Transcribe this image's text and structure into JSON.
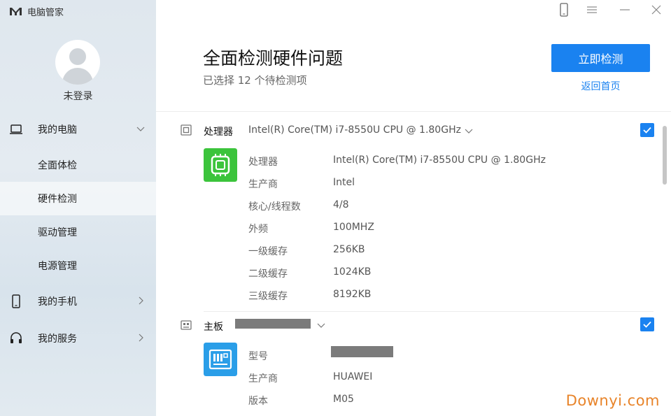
{
  "app": {
    "title": "电脑管家"
  },
  "user": {
    "login_label": "未登录"
  },
  "sidebar": {
    "groups": [
      {
        "label": "我的电脑",
        "icon": "laptop-icon",
        "expanded": true,
        "items": [
          "全面体检",
          "硬件检测",
          "驱动管理",
          "电源管理"
        ],
        "active_item": "硬件检测"
      },
      {
        "label": "我的手机",
        "icon": "phone-icon",
        "expanded": false
      },
      {
        "label": "我的服务",
        "icon": "headset-icon",
        "expanded": false
      }
    ]
  },
  "titlebar": {
    "icons": [
      "phone-icon",
      "menu-icon",
      "minimize-icon",
      "close-icon"
    ]
  },
  "header": {
    "title": "全面检测硬件问题",
    "subtitle": "已选择 12 个待检测项",
    "primary_button": "立即检测",
    "back_link": "返回首页"
  },
  "sections": {
    "cpu": {
      "name": "处理器",
      "model": "Intel(R) Core(TM) i7-8550U CPU @ 1.80GHz",
      "checked": true,
      "rows": [
        {
          "key": "处理器",
          "value": "Intel(R) Core(TM) i7-8550U CPU @ 1.80GHz"
        },
        {
          "key": "生产商",
          "value": "Intel"
        },
        {
          "key": "核心/线程数",
          "value": "4/8"
        },
        {
          "key": "外频",
          "value": "100MHZ"
        },
        {
          "key": "一级缓存",
          "value": "256KB"
        },
        {
          "key": "二级缓存",
          "value": "1024KB"
        },
        {
          "key": "三级缓存",
          "value": "8192KB"
        }
      ]
    },
    "board": {
      "name": "主板",
      "checked": true,
      "rows": [
        {
          "key": "型号",
          "value": ""
        },
        {
          "key": "生产商",
          "value": "HUAWEI"
        },
        {
          "key": "版本",
          "value": "M05"
        }
      ]
    }
  },
  "colors": {
    "accent": "#1a82f0",
    "cpu_icon_bg": "#3cc43c",
    "board_icon_bg": "#2a9ee8",
    "watermark": "#e8842a"
  },
  "watermark": "Downyi.com"
}
